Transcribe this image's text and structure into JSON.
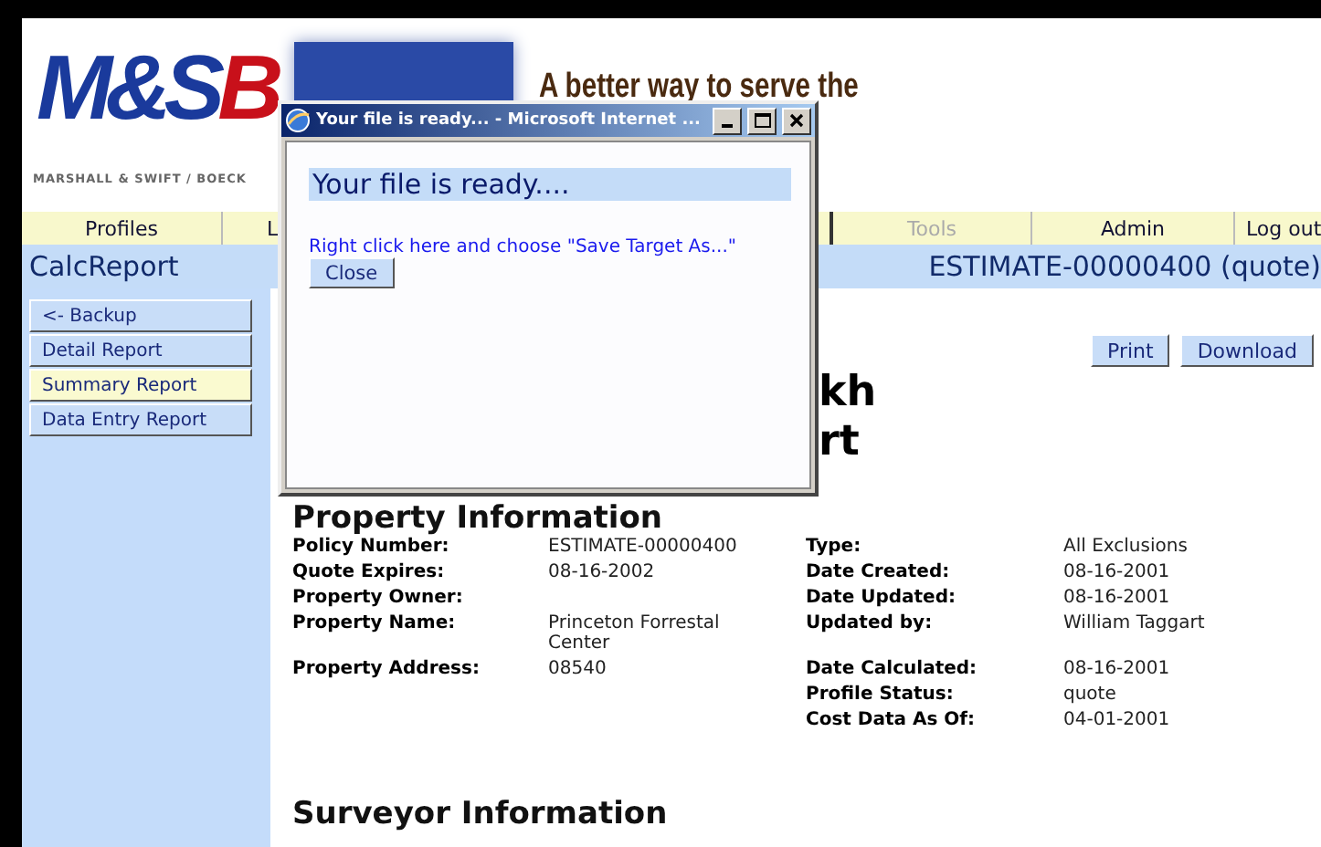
{
  "header": {
    "logo": [
      "M&S",
      "B"
    ],
    "tagline": "A better way to serve the",
    "company": "MARSHALL & SWIFT / BOECK"
  },
  "nav": [
    {
      "label": "Profiles",
      "disabled": false,
      "kind": "full"
    },
    {
      "label": "L",
      "disabled": false,
      "kind": "cut"
    },
    {
      "label": "Tools",
      "disabled": true,
      "kind": "full"
    },
    {
      "label": "Admin",
      "disabled": false,
      "kind": "full"
    },
    {
      "label": "Log out",
      "disabled": false,
      "kind": "edge"
    }
  ],
  "title_bar": {
    "app": "CalcReport",
    "record": "ESTIMATE-00000400 (quote)"
  },
  "sidebar": {
    "items": [
      {
        "label": "<- Backup",
        "selected": false
      },
      {
        "label": "Detail Report",
        "selected": false
      },
      {
        "label": "Summary Report",
        "selected": true
      },
      {
        "label": "Data Entry Report",
        "selected": false
      }
    ]
  },
  "toolbar": [
    "Print",
    "Download"
  ],
  "report_title": [
    "kh",
    "rt"
  ],
  "property_section": {
    "heading": "Property Information",
    "rows": [
      {
        "label": "Policy Number:",
        "value": "ESTIMATE-00000400",
        "label_2": "Type:",
        "value_2": "All Exclusions"
      },
      {
        "label": "Quote Expires:",
        "value": "08-16-2002",
        "label_2": "Date Created:",
        "value_2": "08-16-2001"
      },
      {
        "label": "Property Owner:",
        "value_2": "08-16-2001",
        "label_2": "Date Updated:"
      },
      {
        "label": "Property Name:",
        "value": "Princeton Forrestal Center",
        "label_2": "Updated by:",
        "value_2": "William Taggart"
      },
      {
        "label": "Property Address:",
        "value": "08540",
        "label_2": "Date Calculated:",
        "value_2": "08-16-2001"
      },
      {
        "label_2": "Profile Status:",
        "value_2": "quote"
      },
      {
        "label_2": "Cost Data As Of:",
        "value_2": "04-01-2001"
      }
    ]
  },
  "surveyor_section": {
    "heading": "Surveyor Information"
  },
  "popup": {
    "title": "Your file is ready... - Microsoft Internet ...",
    "heading": "Your file is ready....",
    "link": "Right click here and choose \"Save Target As...\"",
    "button": "Close"
  }
}
